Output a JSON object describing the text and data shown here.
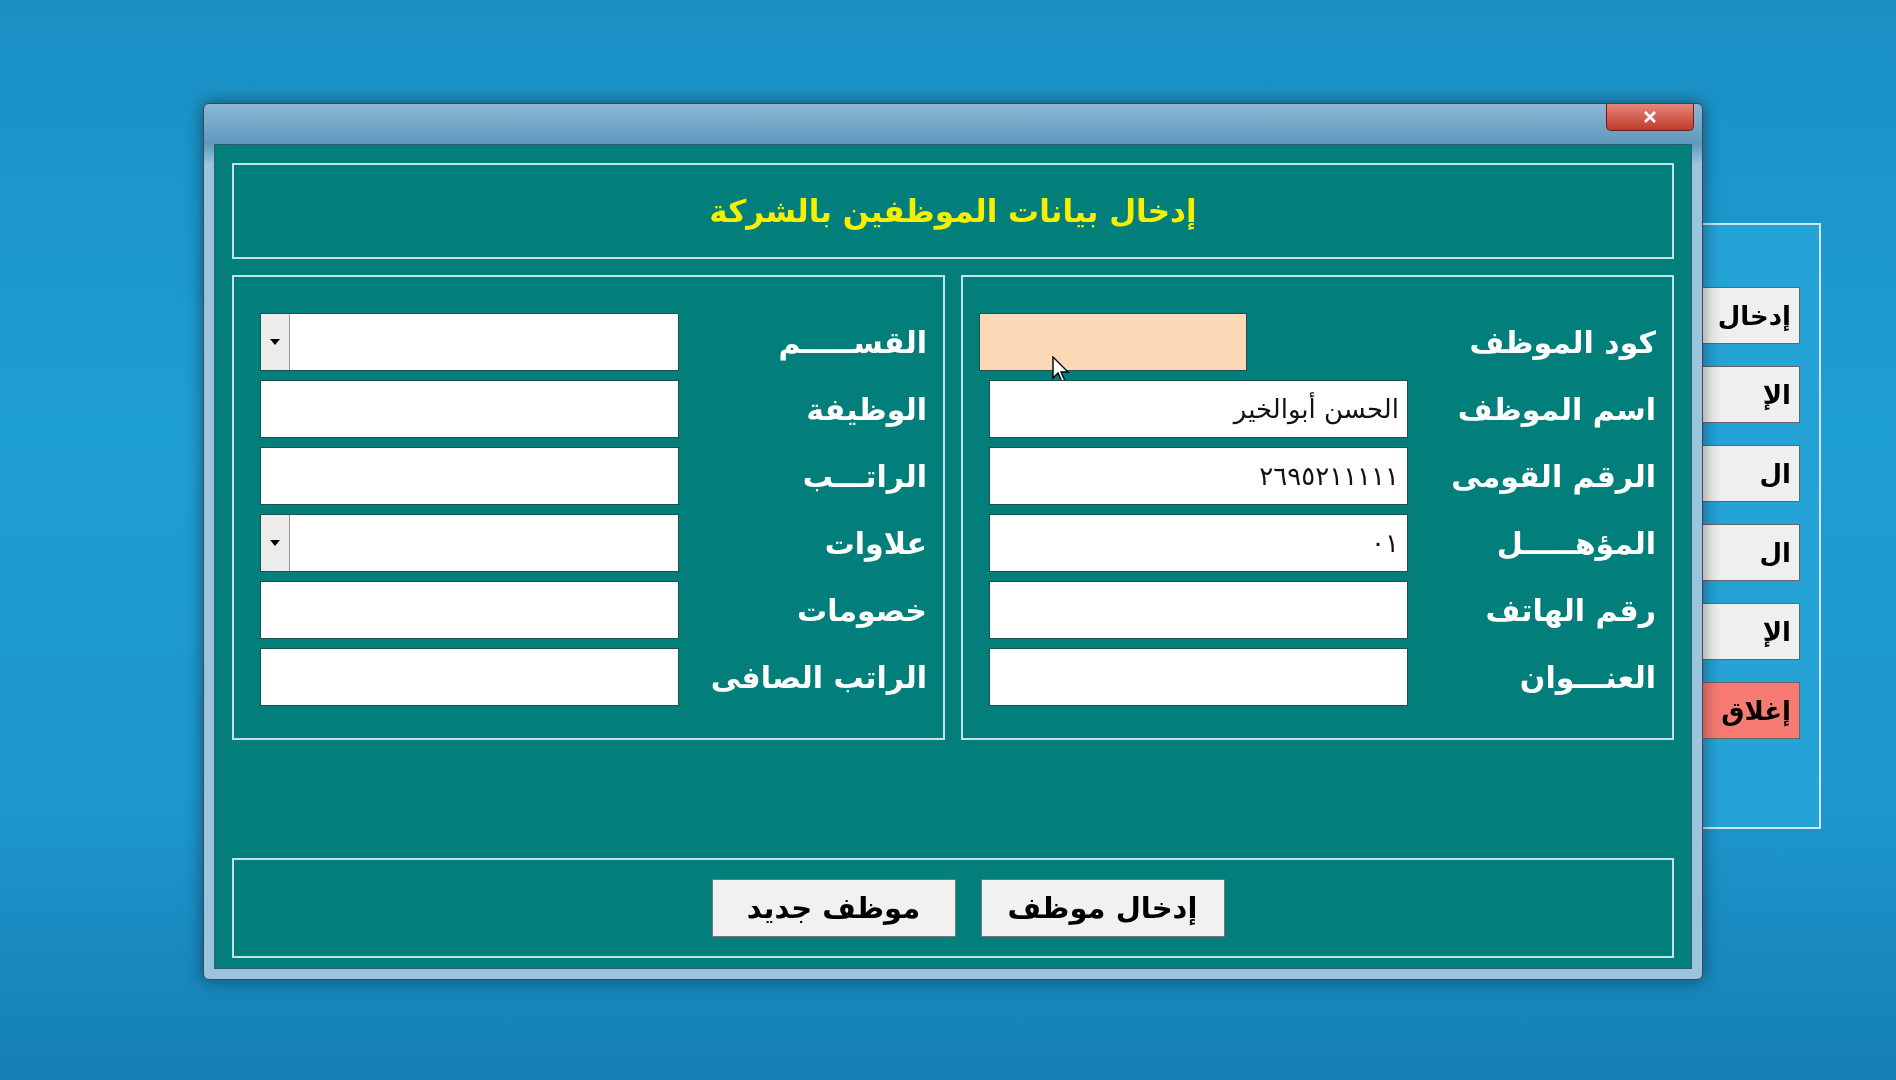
{
  "background_window": {
    "buttons": [
      {
        "label": "إدخال",
        "kind": "normal"
      },
      {
        "label": "الإ",
        "kind": "normal"
      },
      {
        "label": "ال",
        "kind": "normal"
      },
      {
        "label": "ال",
        "kind": "normal"
      },
      {
        "label": "الإ",
        "kind": "normal"
      },
      {
        "label": "إغلاق",
        "kind": "close"
      }
    ]
  },
  "dialog": {
    "title": "إدخال بيانات الموظفين بالشركة",
    "groups": [
      {
        "fields": [
          {
            "label": "كود الموظف",
            "kind": "text",
            "focused": true
          },
          {
            "label": "اسم الموظف",
            "kind": "text",
            "focused": false,
            "value": "الحسن أبوالخير"
          },
          {
            "label": "الرقم القومى",
            "kind": "text",
            "focused": false,
            "value": "٢٦٩٥٢١١١١١"
          },
          {
            "label": "المؤهـــــل",
            "kind": "text",
            "focused": false,
            "value": "٠١"
          },
          {
            "label": "رقم الهاتف",
            "kind": "text",
            "focused": false
          },
          {
            "label": "العنـــوان",
            "kind": "text",
            "focused": false
          }
        ]
      },
      {
        "fields": [
          {
            "label": "القســـــم",
            "kind": "combo",
            "focused": false
          },
          {
            "label": "الوظيفة",
            "kind": "text",
            "focused": false
          },
          {
            "label": "الراتـــب",
            "kind": "text",
            "focused": false
          },
          {
            "label": "علاوات",
            "kind": "combo",
            "focused": false
          },
          {
            "label": "خصومات",
            "kind": "text",
            "focused": false
          },
          {
            "label": "الراتب الصافى",
            "kind": "text",
            "focused": false
          }
        ]
      }
    ],
    "buttons": [
      "إدخال موظف",
      "موظف جديد"
    ]
  }
}
